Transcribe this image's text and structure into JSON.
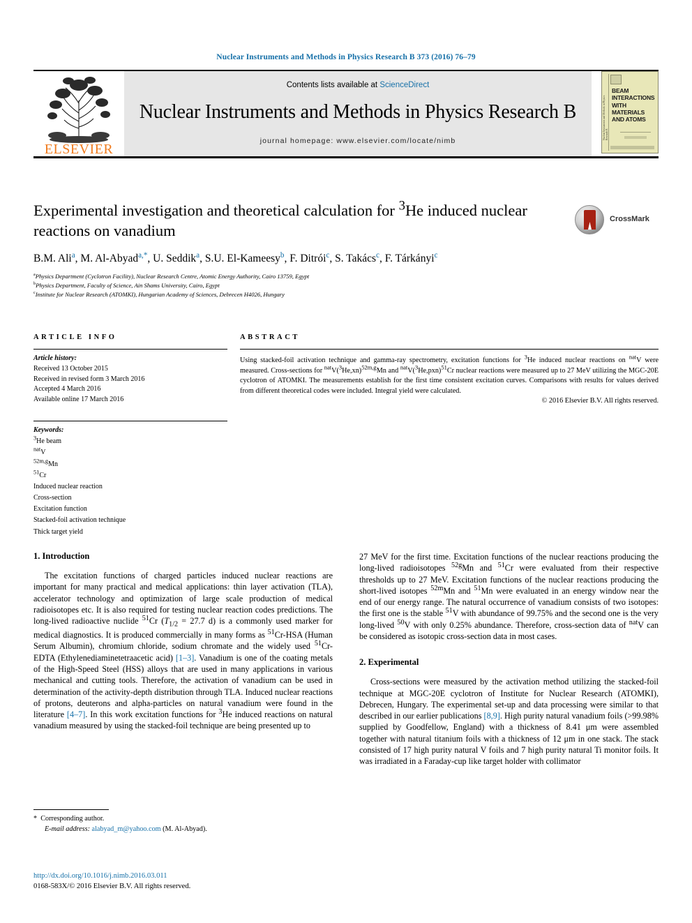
{
  "running_head": "Nuclear Instruments and Methods in Physics Research B 373 (2016) 76–79",
  "masthead": {
    "contents_prefix": "Contents lists available at ",
    "sciencedirect": "ScienceDirect",
    "journal_title": "Nuclear Instruments and Methods in Physics Research B",
    "homepage": "journal homepage: www.elsevier.com/locate/nimb",
    "publisher_logo_text": "ELSEVIER",
    "cover_title": "BEAM INTERACTIONS WITH MATERIALS AND ATOMS",
    "cover_spine_text": "Nuclear Instruments and Methods in Physics Research B"
  },
  "article": {
    "title": "Experimental investigation and theoretical calculation for ³He induced nuclear reactions on vanadium",
    "crossmark_label": "CrossMark",
    "authors": "B.M. Ali a, M. Al-Abyad a,*, U. Seddik a, S.U. El-Kameesy b, F. Ditrói c, S. Takács c, F. Tárkányi c",
    "affiliations": [
      {
        "marker": "a",
        "text": "Physics Department (Cyclotron Facility), Nuclear Research Centre, Atomic Energy Authority, Cairo 13759, Egypt"
      },
      {
        "marker": "b",
        "text": "Physics Department, Faculty of Science, Ain Shams University, Cairo, Egypt"
      },
      {
        "marker": "c",
        "text": "Institute for Nuclear Research (ATOMKI), Hungarian Academy of Sciences, Debrecen H4026, Hungary"
      }
    ]
  },
  "article_info": {
    "heading": "ARTICLE INFO",
    "history_label": "Article history:",
    "history": [
      "Received 13 October 2015",
      "Received in revised form 3 March 2016",
      "Accepted 4 March 2016",
      "Available online 17 March 2016"
    ],
    "keywords_label": "Keywords:",
    "keywords": [
      "³He beam",
      "natV",
      "52m,gMn",
      "51Cr",
      "Induced nuclear reaction",
      "Cross-section",
      "Excitation function",
      "Stacked-foil activation technique",
      "Thick target yield"
    ]
  },
  "abstract": {
    "heading": "ABSTRACT",
    "text": "Using stacked-foil activation technique and gamma-ray spectrometry, excitation functions for ³He induced nuclear reactions on natV were measured. Cross-sections for natV(³He,xn)52m,gMn and natV(³He,pxn)51Cr nuclear reactions were measured up to 27 MeV utilizing the MGC-20E cyclotron of ATOMKI. The measurements establish for the first time consistent excitation curves. Comparisons with results for values derived from different theoretical codes were included. Integral yield were calculated.",
    "copyright": "© 2016 Elsevier B.V. All rights reserved."
  },
  "sections": {
    "introduction_heading": "1. Introduction",
    "introduction_p1": "The excitation functions of charged particles induced nuclear reactions are important for many practical and medical applications: thin layer activation (TLA), accelerator technology and optimization of large scale production of medical radioisotopes etc. It is also required for testing nuclear reaction codes predictions. The long-lived radioactive nuclide 51Cr (T1/2 = 27.7 d) is a commonly used marker for medical diagnostics. It is produced commercially in many forms as 51Cr-HSA (Human Serum Albumin), chromium chloride, sodium chromate and the widely used 51Cr-EDTA (Ethylenediaminetetraacetic acid) [1–3]. Vanadium is one of the coating metals of the High-Speed Steel (HSS) alloys that are used in many applications in various mechanical and cutting tools. Therefore, the activation of vanadium can be used in determination of the activity-depth distribution through TLA. Induced nuclear reactions of protons, deuterons and alpha-particles on natural vanadium were found in the literature [4–7]. In this work excitation functions for ³He induced reactions on natural vanadium measured by using the stacked-foil technique are being presented up to 27 MeV for the first time. Excitation functions of the nuclear reactions producing the long-lived radioisotopes 52gMn and 51Cr were evaluated from their respective thresholds up to 27 MeV. Excitation functions of the nuclear reactions producing the short-lived isotopes 52mMn and 51Mn were evaluated in an energy window near the end of our energy range. The natural occurrence of vanadium consists of two isotopes: the first one is the stable 51V with abundance of 99.75% and the second one is the very long-lived 50V with only 0.25% abundance. Therefore, cross-section data of natV can be considered as isotopic cross-section data in most cases.",
    "experimental_heading": "2. Experimental",
    "experimental_p1": "Cross-sections were measured by the activation method utilizing the stacked-foil technique at MGC-20E cyclotron of Institute for Nuclear Research (ATOMKI), Debrecen, Hungary. The experimental set-up and data processing were similar to that described in our earlier publications [8,9]. High purity natural vanadium foils (>99.98% supplied by Goodfellow, England) with a thickness of 8.41 μm were assembled together with natural titanium foils with a thickness of 12 μm in one stack. The stack consisted of 17 high purity natural V foils and 7 high purity natural Ti monitor foils. It was irradiated in a Faraday-cup like target holder with collimator"
  },
  "footnote": {
    "corresponding_marker": "*",
    "corresponding_text": "Corresponding author.",
    "email_label": "E-mail address:",
    "email": "alabyad_m@yahoo.com",
    "email_owner": "(M. Al-Abyad)."
  },
  "footer": {
    "doi": "http://dx.doi.org/10.1016/j.nimb.2016.03.011",
    "issn_copyright": "0168-583X/© 2016 Elsevier B.V. All rights reserved."
  },
  "colors": {
    "link": "#1670a8",
    "elsevier_orange": "#f07c1f",
    "crossmark_red": "#a62214"
  }
}
